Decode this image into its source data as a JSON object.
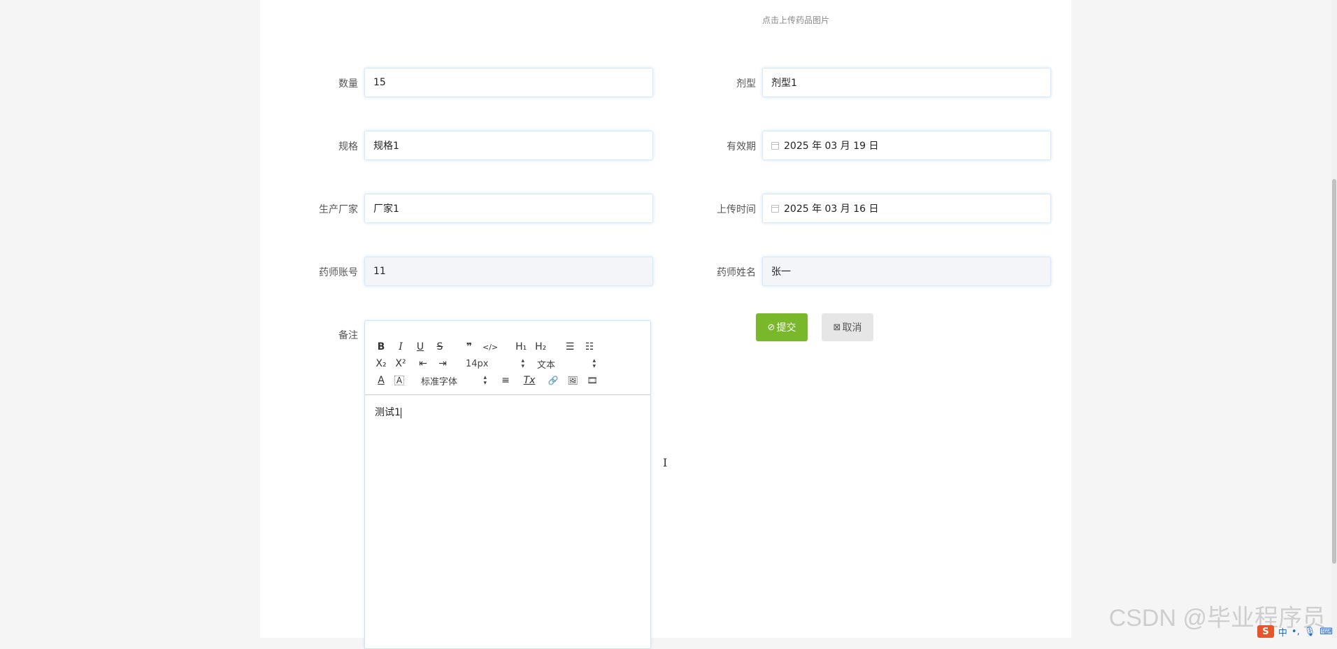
{
  "form": {
    "upload_hint": "点击上传药品图片",
    "fields": [
      {
        "label": "数量",
        "value": "15"
      },
      {
        "label": "剂型",
        "value": "剂型1"
      },
      {
        "label": "规格",
        "value": "规格1"
      },
      {
        "label": "有效期",
        "value": "2025 年 03 月 19 日"
      },
      {
        "label": "生产厂家",
        "value": "厂家1"
      },
      {
        "label": "上传时间",
        "value": "2025 年 03 月 16 日"
      },
      {
        "label": "药师账号",
        "value": "11"
      },
      {
        "label": "药师姓名",
        "value": "张一"
      }
    ],
    "remark_label": "备注"
  },
  "editor": {
    "toolbar": {
      "bold": "B",
      "italic": "I",
      "underline": "U",
      "strike": "S",
      "blockquote": "❞",
      "code": "</>",
      "h1": "H₁",
      "h2": "H₂",
      "ordered_list": "☰",
      "bullet_list": "☷",
      "subscript": "X₂",
      "superscript": "X²",
      "outdent": "⇤",
      "indent": "⇥",
      "size": "14px",
      "header": "文本",
      "font_color": "A",
      "background": "A",
      "font_family": "标准字体",
      "align": "≡",
      "clean": "Tx",
      "link": "🔗",
      "image": "🖼",
      "video": "🎞"
    },
    "content": "测试1"
  },
  "actions": {
    "submit": "提交",
    "cancel": "取消"
  },
  "overlay": {
    "watermark": "CSDN @毕业程序员",
    "ime_logo": "S",
    "ime_lang": "中"
  },
  "colors": {
    "submit_bg": "#79b82a",
    "cancel_bg": "#e6e6e6",
    "field_border": "#d6eaf8"
  }
}
